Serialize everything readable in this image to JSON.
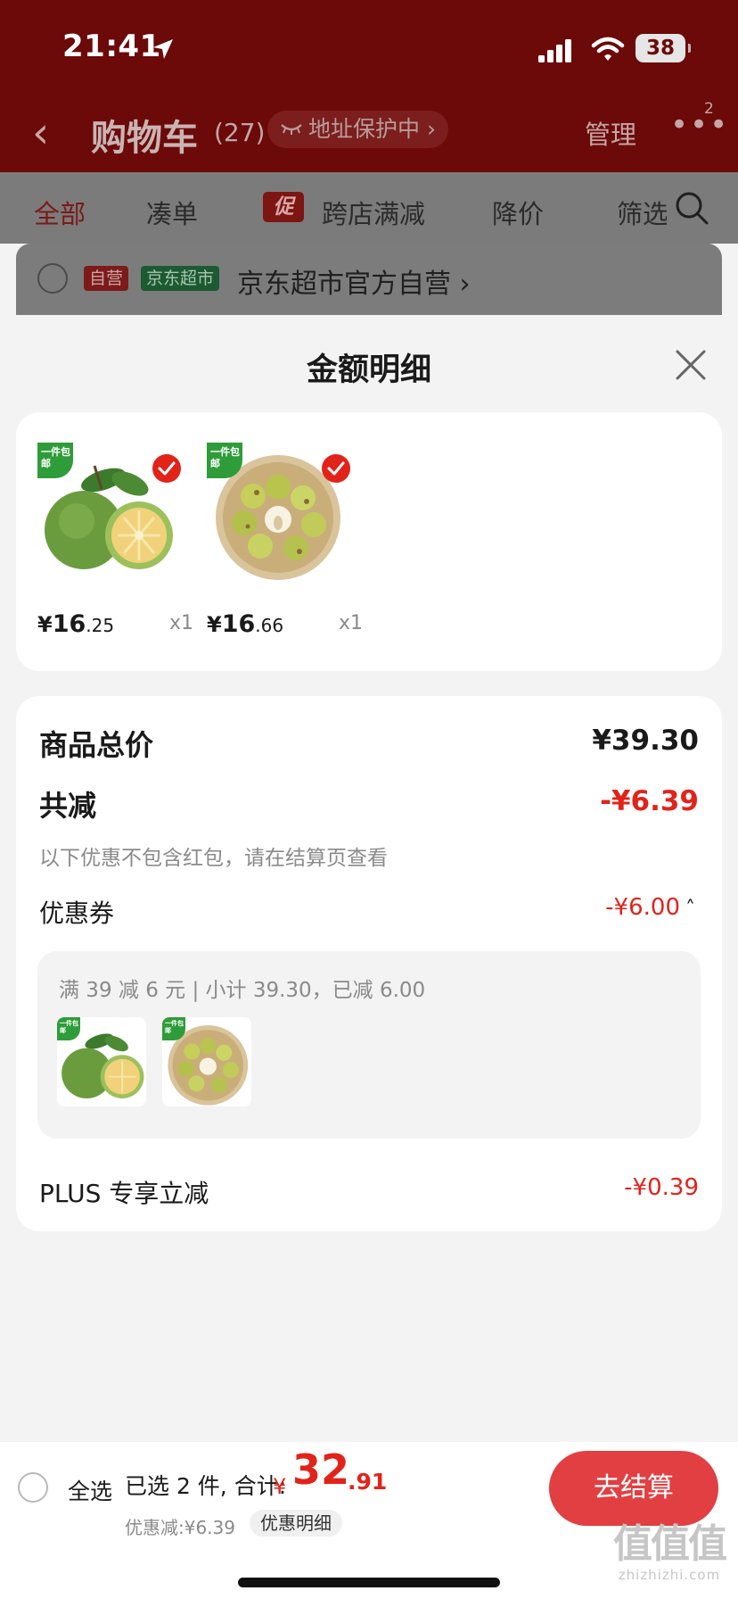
{
  "status_bar": {
    "time": "21:41",
    "battery": "38"
  },
  "header": {
    "back_icon": "‹",
    "title": "购物车",
    "count": "(27)",
    "address_protect": "地址保护中 ›",
    "manage": "管理",
    "more": "•••",
    "badge": "2"
  },
  "filters": {
    "all": "全部",
    "bundle": "凑单",
    "promo_tag": "促",
    "cross_store": "跨店满减",
    "price_drop": "降价",
    "filter": "筛选"
  },
  "store": {
    "tag_self": "自营",
    "tag_super": "京东超市",
    "name": "京东超市官方自营 ›"
  },
  "sheet": {
    "title": "金额明细",
    "products": [
      {
        "name": "grapefruit",
        "tag": "一件包邮",
        "currency": "¥",
        "price_int": "16",
        "price_dec": ".25",
        "qty": "x1"
      },
      {
        "name": "jujube",
        "tag": "一件包邮",
        "currency": "¥",
        "price_int": "16",
        "price_dec": ".66",
        "qty": "x1"
      }
    ],
    "summary": {
      "total_label": "商品总价",
      "total_value": "¥39.30",
      "reduce_label": "共减",
      "reduce_value": "-¥6.39",
      "reduce_note": "以下优惠不包含红包，请在结算页查看",
      "coupon_label": "优惠券",
      "coupon_value": "-¥6.00",
      "coupon_rule": "满 39 减 6 元 | 小计 39.30，已减 6.00",
      "plus_label": "PLUS 专享立减",
      "plus_value": "-¥0.39"
    }
  },
  "bottom": {
    "select_all": "全选",
    "selected_info": "已选 2 件, 合计:",
    "currency": "¥",
    "total_int": "32",
    "total_dec": ".91",
    "discount": "优惠减:¥6.39",
    "detail": "优惠明细",
    "checkout": "去结算"
  },
  "watermark": {
    "logo": "值值值",
    "site": "zhizhizhi.com"
  },
  "colors": {
    "header_bg": "#6b0a09",
    "accent_red": "#e2231a",
    "checkout_bg": "#e23f42",
    "free_ship_green": "#2f9c3a"
  }
}
